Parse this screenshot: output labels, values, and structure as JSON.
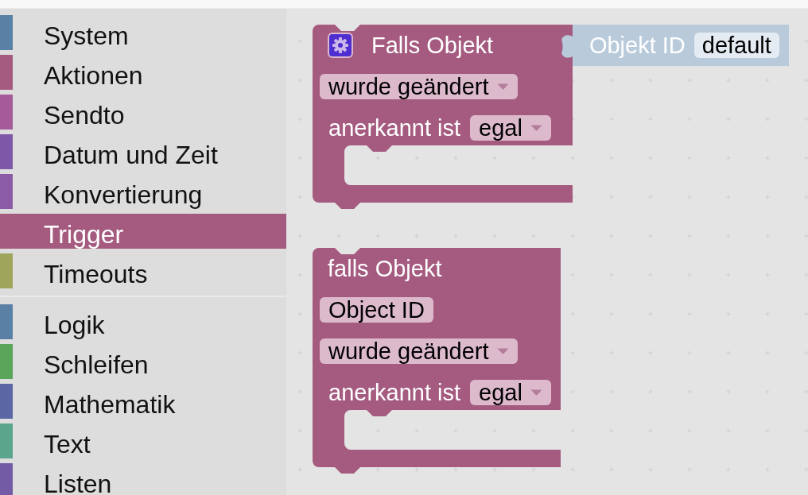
{
  "sidebar": {
    "groups": [
      {
        "items": [
          {
            "label": "System",
            "color": "#5b80a5",
            "selected": false
          },
          {
            "label": "Aktionen",
            "color": "#a55b80",
            "selected": false
          },
          {
            "label": "Sendto",
            "color": "#a55b9a",
            "selected": false
          },
          {
            "label": "Datum und Zeit",
            "color": "#7e58a8",
            "selected": false
          },
          {
            "label": "Konvertierung",
            "color": "#8b5ba8",
            "selected": false
          },
          {
            "label": "Trigger",
            "color": "#a55b80",
            "selected": true
          },
          {
            "label": "Timeouts",
            "color": "#9fa55b",
            "selected": false
          }
        ]
      },
      {
        "items": [
          {
            "label": "Logik",
            "color": "#5b80a5",
            "selected": false
          },
          {
            "label": "Schleifen",
            "color": "#5ba55b",
            "selected": false
          },
          {
            "label": "Mathematik",
            "color": "#5b67a5",
            "selected": false
          },
          {
            "label": "Text",
            "color": "#5ba58c",
            "selected": false
          },
          {
            "label": "Listen",
            "color": "#745ba5",
            "selected": false
          }
        ]
      }
    ]
  },
  "workspace": {
    "blocks": [
      {
        "title": "Falls Objekt",
        "mutator": true,
        "value_input": {
          "label": "Objekt ID",
          "value": "default"
        },
        "rows": [
          {
            "items": [
              {
                "kind": "dropdown",
                "value": "wurde geändert"
              }
            ]
          },
          {
            "items": [
              {
                "kind": "label",
                "text": "anerkannt ist"
              },
              {
                "kind": "dropdown",
                "value": "egal"
              }
            ]
          }
        ]
      },
      {
        "title": "falls Objekt",
        "mutator": false,
        "rows": [
          {
            "items": [
              {
                "kind": "text_field",
                "value": "Object ID"
              }
            ]
          },
          {
            "items": [
              {
                "kind": "dropdown",
                "value": "wurde geändert"
              }
            ]
          },
          {
            "items": [
              {
                "kind": "label",
                "text": "anerkannt ist"
              },
              {
                "kind": "dropdown",
                "value": "egal"
              }
            ]
          }
        ]
      }
    ]
  }
}
